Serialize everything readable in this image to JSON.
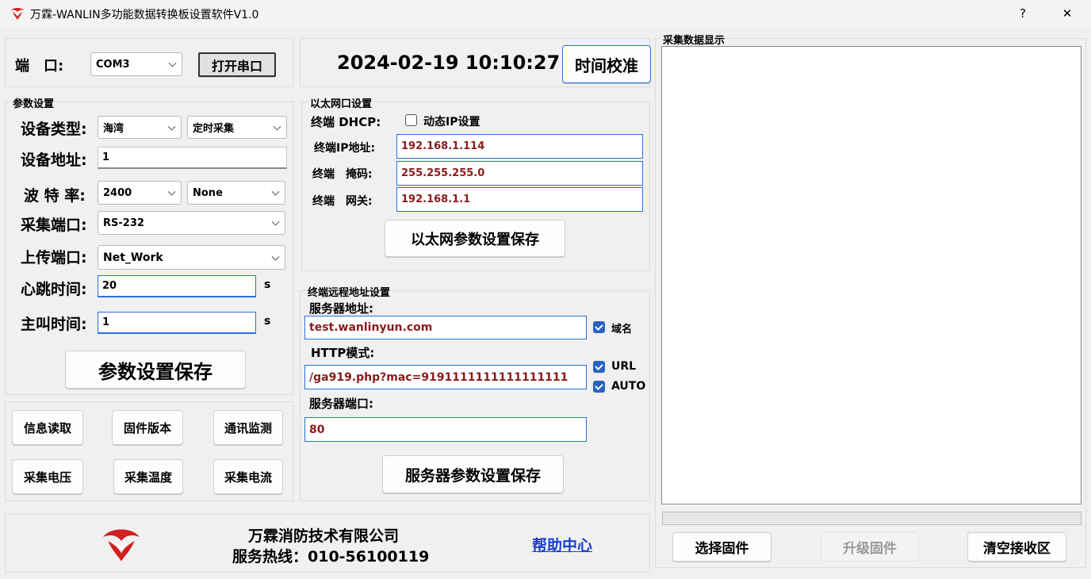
{
  "window": {
    "title": "万霖-WANLIN多功能数据转换板设置软件V1.0",
    "help": "?",
    "close": "✕"
  },
  "port": {
    "label": "端　口:",
    "value": "COM3",
    "open_button": "打开串口"
  },
  "clock": {
    "datetime": "2024-02-19 10:10:27",
    "calibrate_button": "时间校准"
  },
  "params": {
    "group_title": "参数设置",
    "device_type_label": "设备类型:",
    "device_type": "海湾",
    "collect_mode": "定时采集",
    "device_addr_label": "设备地址:",
    "device_addr": "1",
    "baud_label": "波 特 率:",
    "baud": "2400",
    "parity": "None",
    "collect_port_label": "采集端口:",
    "collect_port": "RS-232",
    "upload_port_label": "上传端口:",
    "upload_port": "Net_Work",
    "heartbeat_label": "心跳时间:",
    "heartbeat": "20",
    "heartbeat_unit": "s",
    "call_label": "主叫时间:",
    "call": "1",
    "call_unit": "s",
    "save_button": "参数设置保存"
  },
  "tools": {
    "read_info": "信息读取",
    "firmware_version": "固件版本",
    "comm_monitor": "通讯监测",
    "collect_voltage": "采集电压",
    "collect_temp": "采集温度",
    "collect_current": "采集电流"
  },
  "ethernet": {
    "group_title": "以太网口设置",
    "dhcp_label": "终端 DHCP:",
    "dhcp_check_label": "动态IP设置",
    "ip_label": "终端IP地址:",
    "ip": "192.168.1.114",
    "mask_label": "终端　掩码:",
    "mask": "255.255.255.0",
    "gateway_label": "终端　网关:",
    "gateway": "192.168.1.1",
    "save_button": "以太网参数设置保存"
  },
  "remote": {
    "group_title": "终端远程地址设置",
    "server_label": "服务器地址:",
    "server": "test.wanlinyun.com",
    "domain_label": "域名",
    "http_label": "HTTP模式:",
    "http": "/ga919.php?mac=9191111111111111111",
    "url_label": "URL",
    "auto_label": "AUTO",
    "port_label": "服务器端口:",
    "port": "80",
    "save_button": "服务器参数设置保存"
  },
  "footer": {
    "company": "万霖消防技术有限公司",
    "hotline": "服务热线：010-56100119",
    "help_link": "帮助中心"
  },
  "display": {
    "group_title": "采集数据显示",
    "select_firmware": "选择固件",
    "upgrade_firmware": "升级固件",
    "clear_receive": "清空接收区",
    "progress": 0
  },
  "colors": {
    "accent_blue": "#2a6fdb",
    "value_red": "#8b1a1a",
    "logo_red": "#d21f1f",
    "link_blue": "#1a3fcc"
  }
}
